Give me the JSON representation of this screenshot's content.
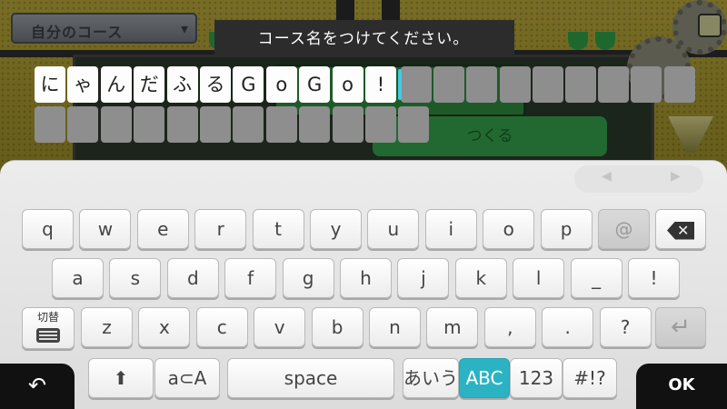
{
  "scene": {
    "course_tab_label": "自分のコース",
    "create_button_label": "つくる"
  },
  "prompt": "コース名をつけてください。",
  "input": {
    "chars": [
      "に",
      "ゃ",
      "ん",
      "だ",
      "ふ",
      "る",
      "G",
      "o",
      "G",
      "o",
      "!"
    ],
    "total_cells": 32
  },
  "keyboard": {
    "row1": [
      "q",
      "w",
      "e",
      "r",
      "t",
      "y",
      "u",
      "i",
      "o",
      "p",
      "@"
    ],
    "row2": [
      "a",
      "s",
      "d",
      "f",
      "g",
      "h",
      "j",
      "k",
      "l",
      "_",
      "!"
    ],
    "row3": [
      "z",
      "x",
      "c",
      "v",
      "b",
      "n",
      "m",
      ",",
      ".",
      "?"
    ],
    "switch_label": "切替",
    "shift_icon": "up-arrow-icon",
    "case_label": "a⊂A",
    "space_label": "space",
    "mode_hiragana": "あいう",
    "mode_abc": "ABC",
    "mode_numbers": "123",
    "mode_symbols": "#!?",
    "ok_label": "OK",
    "back_icon": "back-arrow-icon",
    "enter_icon": "enter-icon",
    "backspace_icon": "backspace-icon",
    "active_mode": "ABC",
    "accent_color": "#2bb3c4"
  }
}
